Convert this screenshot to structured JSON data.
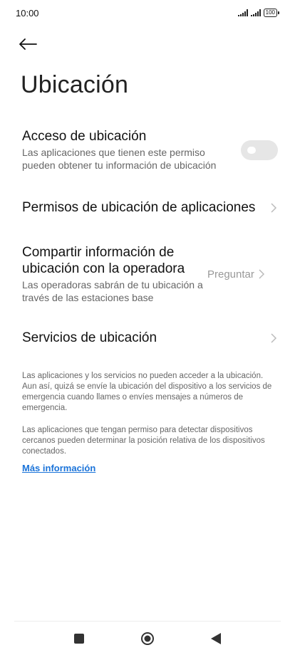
{
  "status_bar": {
    "time": "10:00",
    "battery": "100"
  },
  "header": {
    "title": "Ubicación"
  },
  "settings": {
    "location_access": {
      "title": "Acceso de ubicación",
      "subtitle": "Las aplicaciones que tienen este permiso pueden obtener tu información de ubicación",
      "enabled": false
    },
    "app_permissions": {
      "title": "Permisos de ubicación de aplicaciones"
    },
    "carrier_sharing": {
      "title": "Compartir información de ubicación con la operadora",
      "subtitle": "Las operadoras sabrán de tu ubicación a través de las estaciones base",
      "value": "Preguntar"
    },
    "location_services": {
      "title": "Servicios de ubicación"
    }
  },
  "info": {
    "paragraph1": "Las aplicaciones y los servicios no pueden acceder a la ubicación. Aun así, quizá se envíe la ubicación del dispositivo a los servicios de emergencia cuando llames o envíes mensajes a números de emergencia.",
    "paragraph2": "Las aplicaciones que tengan permiso para detectar dispositivos cercanos pueden determinar la posición relativa de los dispositivos conectados.",
    "more_link": "Más información"
  },
  "colors": {
    "accent": "#1a73d9",
    "toggle_off": "#e6e6e6"
  },
  "icons": {
    "back": "arrow-left-icon",
    "chevron": "chevron-right-icon",
    "nav_recents": "square-icon",
    "nav_home": "circle-icon",
    "nav_back": "triangle-icon"
  }
}
